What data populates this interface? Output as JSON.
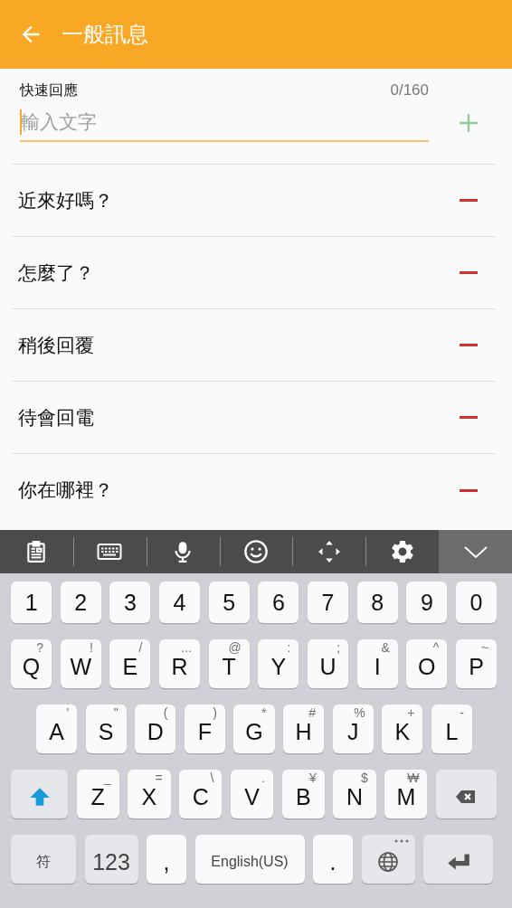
{
  "app_bar": {
    "title": "一般訊息"
  },
  "quick_reply": {
    "label": "快速回應",
    "counter": "0/160",
    "placeholder": "輸入文字"
  },
  "replies": [
    {
      "text": "近來好嗎？"
    },
    {
      "text": "怎麼了？"
    },
    {
      "text": "稍後回覆"
    },
    {
      "text": "待會回電"
    },
    {
      "text": "你在哪裡？"
    }
  ],
  "keyboard": {
    "rows": [
      [
        {
          "kind": "key",
          "label": "1"
        },
        {
          "kind": "key",
          "label": "2"
        },
        {
          "kind": "key",
          "label": "3"
        },
        {
          "kind": "key",
          "label": "4"
        },
        {
          "kind": "key",
          "label": "5"
        },
        {
          "kind": "key",
          "label": "6"
        },
        {
          "kind": "key",
          "label": "7"
        },
        {
          "kind": "key",
          "label": "8"
        },
        {
          "kind": "key",
          "label": "9"
        },
        {
          "kind": "key",
          "label": "0"
        }
      ],
      [
        {
          "kind": "key",
          "label": "Q",
          "hint": "?"
        },
        {
          "kind": "key",
          "label": "W",
          "hint": "!"
        },
        {
          "kind": "key",
          "label": "E",
          "hint": "/"
        },
        {
          "kind": "key",
          "label": "R",
          "hint": "..."
        },
        {
          "kind": "key",
          "label": "T",
          "hint": "@"
        },
        {
          "kind": "key",
          "label": "Y",
          "hint": ":"
        },
        {
          "kind": "key",
          "label": "U",
          "hint": ";"
        },
        {
          "kind": "key",
          "label": "I",
          "hint": "&"
        },
        {
          "kind": "key",
          "label": "O",
          "hint": "^"
        },
        {
          "kind": "key",
          "label": "P",
          "hint": "~"
        }
      ],
      [
        {
          "kind": "key",
          "label": "A",
          "hint": "'"
        },
        {
          "kind": "key",
          "label": "S",
          "hint": "\""
        },
        {
          "kind": "key",
          "label": "D",
          "hint": "("
        },
        {
          "kind": "key",
          "label": "F",
          "hint": ")"
        },
        {
          "kind": "key",
          "label": "G",
          "hint": "*"
        },
        {
          "kind": "key",
          "label": "H",
          "hint": "#"
        },
        {
          "kind": "key",
          "label": "J",
          "hint": "%"
        },
        {
          "kind": "key",
          "label": "K",
          "hint": "+"
        },
        {
          "kind": "key",
          "label": "L",
          "hint": "-"
        }
      ],
      [
        {
          "kind": "shift"
        },
        {
          "kind": "key",
          "label": "Z",
          "hint": "_"
        },
        {
          "kind": "key",
          "label": "X",
          "hint": "="
        },
        {
          "kind": "key",
          "label": "C",
          "hint": "\\"
        },
        {
          "kind": "key",
          "label": "V",
          "hint": "."
        },
        {
          "kind": "key",
          "label": "B",
          "hint": "¥"
        },
        {
          "kind": "key",
          "label": "N",
          "hint": "$"
        },
        {
          "kind": "key",
          "label": "M",
          "hint": "₩"
        },
        {
          "kind": "backspace"
        }
      ],
      [
        {
          "kind": "symbols",
          "label": "符"
        },
        {
          "kind": "numbers",
          "label": "123"
        },
        {
          "kind": "punct",
          "label": ","
        },
        {
          "kind": "space",
          "label": "English(US)"
        },
        {
          "kind": "punct",
          "label": "."
        },
        {
          "kind": "language"
        },
        {
          "kind": "enter"
        }
      ]
    ]
  }
}
